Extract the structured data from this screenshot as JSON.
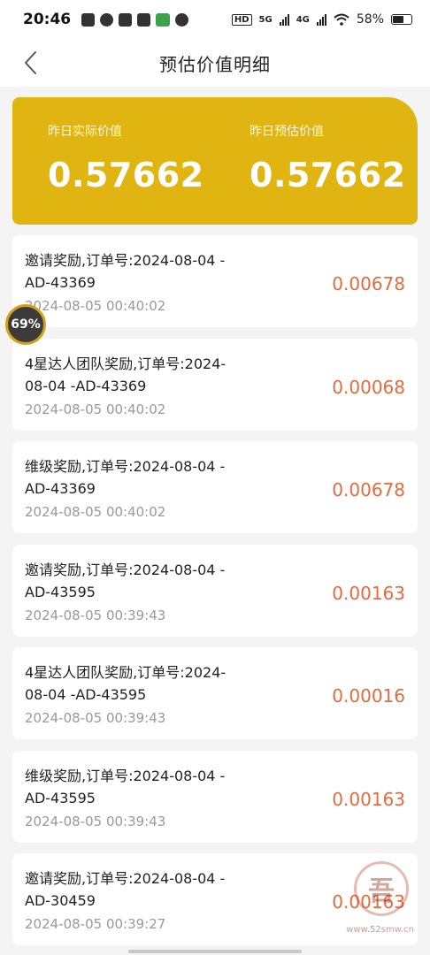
{
  "status_bar": {
    "time": "20:46",
    "network_labels": [
      "5G",
      "4G"
    ],
    "battery": "58%"
  },
  "header": {
    "title": "预估价值明细"
  },
  "summary": {
    "actual_label": "昨日实际价值",
    "actual_value": "0.57662",
    "estimate_label": "昨日预估价值",
    "estimate_value": "0.57662"
  },
  "items": [
    {
      "title": "邀请奖励,订单号:2024-08-04 -AD-43369",
      "time": "2024-08-05 00:40:02",
      "amount": "0.00678"
    },
    {
      "title": "4星达人团队奖励,订单号:2024-08-04 -AD-43369",
      "time": "2024-08-05 00:40:02",
      "amount": "0.00068"
    },
    {
      "title": "维级奖励,订单号:2024-08-04 -AD-43369",
      "time": "2024-08-05 00:40:02",
      "amount": "0.00678"
    },
    {
      "title": "邀请奖励,订单号:2024-08-04 -AD-43595",
      "time": "2024-08-05 00:39:43",
      "amount": "0.00163"
    },
    {
      "title": "4星达人团队奖励,订单号:2024-08-04 -AD-43595",
      "time": "2024-08-05 00:39:43",
      "amount": "0.00016"
    },
    {
      "title": "维级奖励,订单号:2024-08-04 -AD-43595",
      "time": "2024-08-05 00:39:43",
      "amount": "0.00163"
    },
    {
      "title": "邀请奖励,订单号:2024-08-04 -AD-30459",
      "time": "2024-08-05 00:39:27",
      "amount": "0.00163"
    }
  ],
  "float_badge": "69%",
  "watermark": {
    "text": "www.52smw.cn"
  },
  "colors": {
    "accent": "#e0b411",
    "amount": "#e56a3c",
    "background": "#f4f4f5"
  },
  "icons": [
    "back-chevron-icon",
    "wifi-icon",
    "battery-icon",
    "signal-icon"
  ]
}
